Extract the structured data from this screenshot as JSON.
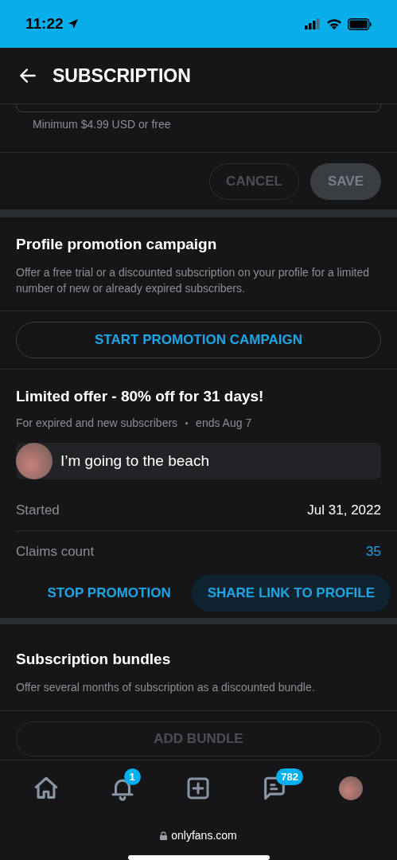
{
  "status_bar": {
    "time": "11:22"
  },
  "header": {
    "title": "SUBSCRIPTION"
  },
  "price_field": {
    "hint": "Minimum $4.99 USD or free"
  },
  "form_buttons": [
    {
      "label": "CANCEL",
      "disabled": true
    },
    {
      "label": "SAVE",
      "disabled": true
    }
  ],
  "promotion": {
    "title": "Profile promotion campaign",
    "description": "Offer a free trial or a discounted subscription on your profile for a limited number of new or already expired subscribers.",
    "button": "START PROMOTION CAMPAIGN"
  },
  "offer": {
    "title": "Limited offer - 80% off for 31 days!",
    "audience": "For expired and new subscribers",
    "ends": "ends Aug 7",
    "message": "I’m going to the beach",
    "details": [
      {
        "label": "Started",
        "value": "Jul 31, 2022",
        "kind": "plain"
      },
      {
        "label": "Claims count",
        "value": "35",
        "kind": "link"
      }
    ],
    "actions": [
      {
        "label": "STOP PROMOTION",
        "kind": "text"
      },
      {
        "label": "SHARE LINK TO PROFILE",
        "kind": "filled"
      }
    ]
  },
  "bundles": {
    "title": "Subscription bundles",
    "description": "Offer several months of subscription as a discounted bundle.",
    "button": "ADD BUNDLE",
    "disabled": true
  },
  "nav": [
    {
      "kind": "home"
    },
    {
      "kind": "bell",
      "badge": "1"
    },
    {
      "kind": "add"
    },
    {
      "kind": "chat",
      "badge": "782"
    },
    {
      "kind": "avatar"
    }
  ],
  "browser": {
    "url": "onlyfans.com"
  }
}
